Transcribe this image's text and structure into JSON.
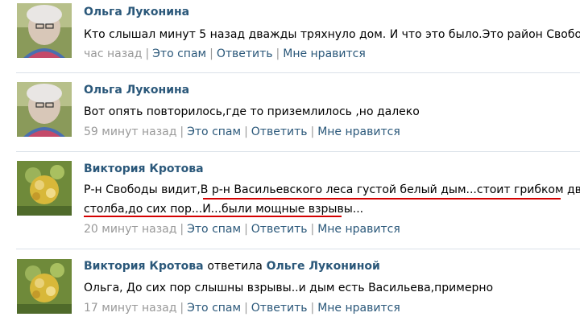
{
  "comments": [
    {
      "author": "Ольга Луконина",
      "text": "Кто слышал минут 5 назад дважды тряхнуло дом. И что это было.Это район Свободы.",
      "time": "час назад",
      "spam": "Это спам",
      "reply": "Ответить",
      "like": "Мне нравится"
    },
    {
      "author": "Ольга Луконина",
      "text": "Вот опять повторилось,где то приземлилось ,но далеко",
      "time": "59 минут назад",
      "spam": "Это спам",
      "reply": "Ответить",
      "like": "Мне нравится"
    },
    {
      "author": "Виктория Кротова",
      "text_line1": "Р-н Свободы видит,В р-н Васильевского леса густой белый дым...стоит грибком два",
      "text_line2": "столба,до сих пор...И...были мощные взрывы...",
      "time": "20 минут назад",
      "spam": "Это спам",
      "reply": "Ответить",
      "like": "Мне нравится"
    },
    {
      "author": "Виктория Кротова",
      "reply_word": "ответила",
      "reply_to": "Ольге Лукониной",
      "text": "Ольга, До сих пор слышны взрывы..и дым есть Васильева,примерно",
      "time": "17 минут назад",
      "spam": "Это спам",
      "reply": "Ответить",
      "like": "Мне нравится"
    }
  ],
  "separator": "|",
  "colors": {
    "link": "#2b587a",
    "meta": "#999999",
    "divider": "#dae1e8",
    "underline": "#d40000"
  }
}
